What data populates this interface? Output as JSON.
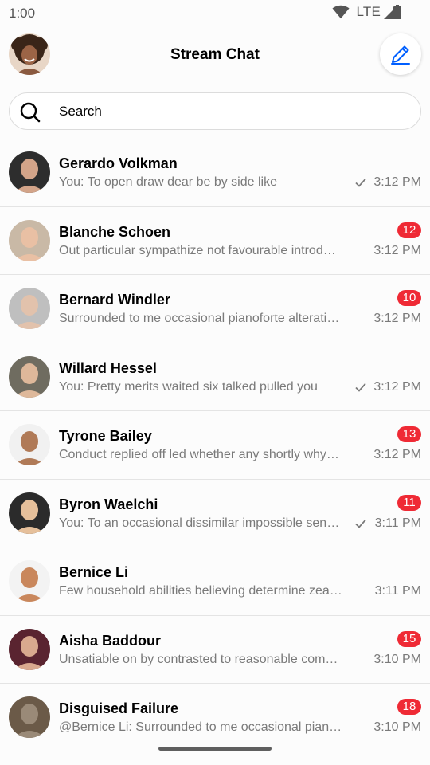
{
  "status_bar": {
    "time": "1:00",
    "network": "LTE"
  },
  "header": {
    "title": "Stream Chat",
    "compose_icon": "pencil-icon",
    "avatar_icon": "user-avatar"
  },
  "search": {
    "placeholder": "Search",
    "icon": "search-icon"
  },
  "colors": {
    "badge": "#ef2a35",
    "accent": "#005fff",
    "muted": "#7a7a7a"
  },
  "channels": [
    {
      "name": "Gerardo Volkman",
      "message": "You: To open draw dear be by side like",
      "time": "3:12 PM",
      "unread": "",
      "read_check": true,
      "avatar_bg": "#2d2d2d",
      "avatar_skin": "#d3a489"
    },
    {
      "name": "Blanche Schoen",
      "message": "Out particular sympathize not favourable introduced...",
      "time": "3:12 PM",
      "unread": "12",
      "read_check": false,
      "avatar_bg": "#c9b9a6",
      "avatar_skin": "#e9c0a4"
    },
    {
      "name": "Bernard Windler",
      "message": "Surrounded to me occasional pianoforte alteration...",
      "time": "3:12 PM",
      "unread": "10",
      "read_check": false,
      "avatar_bg": "#bfbfbf",
      "avatar_skin": "#e2c2ac"
    },
    {
      "name": "Willard Hessel",
      "message": "You: Pretty merits waited six talked pulled you",
      "time": "3:12 PM",
      "unread": "",
      "read_check": true,
      "avatar_bg": "#6f6c60",
      "avatar_skin": "#deb89a"
    },
    {
      "name": "Tyrone Bailey",
      "message": "Conduct replied off led whether any shortly why arrived...",
      "time": "3:12 PM",
      "unread": "13",
      "read_check": false,
      "avatar_bg": "#f1f1f1",
      "avatar_skin": "#b07a57"
    },
    {
      "name": "Byron Waelchi",
      "message": "You: To an occasional dissimilar impossible sentiments...",
      "time": "3:11 PM",
      "unread": "11",
      "read_check": true,
      "avatar_bg": "#2b2b2b",
      "avatar_skin": "#e6c09b"
    },
    {
      "name": "Bernice Li",
      "message": "Few household abilities believing determine zealously...",
      "time": "3:11 PM",
      "unread": "",
      "read_check": false,
      "avatar_bg": "#f3f3f3",
      "avatar_skin": "#c9875c"
    },
    {
      "name": "Aisha Baddour",
      "message": "Unsatiable on by contrasted to reasonable companions...",
      "time": "3:10 PM",
      "unread": "15",
      "read_check": false,
      "avatar_bg": "#5a2430",
      "avatar_skin": "#d9a98e"
    },
    {
      "name": "Disguised Failure",
      "message": "@Bernice Li: Surrounded to me occasional pianoforte...",
      "time": "3:10 PM",
      "unread": "18",
      "read_check": false,
      "avatar_bg": "#6b5a48",
      "avatar_skin": "#9a8a78"
    }
  ]
}
